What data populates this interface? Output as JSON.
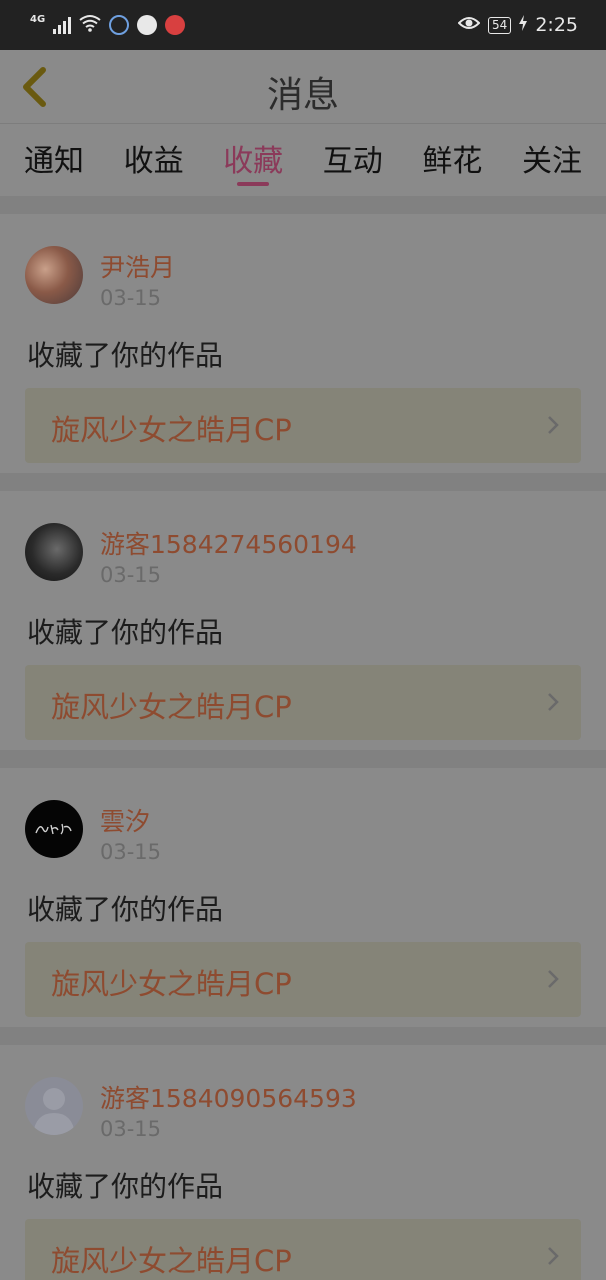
{
  "status_bar": {
    "network": "4G",
    "battery": "54",
    "time": "2:25"
  },
  "header": {
    "title": "消息",
    "back_icon": "chevron-left-icon"
  },
  "tabs": [
    {
      "label": "通知",
      "active": false
    },
    {
      "label": "收益",
      "active": false
    },
    {
      "label": "收藏",
      "active": true
    },
    {
      "label": "互动",
      "active": false
    },
    {
      "label": "鲜花",
      "active": false
    },
    {
      "label": "关注",
      "active": false
    }
  ],
  "feed": [
    {
      "user": "尹浩月",
      "date": "03-15",
      "action": "收藏了你的作品",
      "work": "旋风少女之皓月CP",
      "avatar": "photo"
    },
    {
      "user": "游客1584274560194",
      "date": "03-15",
      "action": "收藏了你的作品",
      "work": "旋风少女之皓月CP",
      "avatar": "dark-photo"
    },
    {
      "user": "雲汐",
      "date": "03-15",
      "action": "收藏了你的作品",
      "work": "旋风少女之皓月CP",
      "avatar": "black-calligraphy"
    },
    {
      "user": "游客1584090564593",
      "date": "03-15",
      "action": "收藏了你的作品",
      "work": "旋风少女之皓月CP",
      "avatar": "default-user"
    }
  ],
  "colors": {
    "accent": "#8b3a5a",
    "name": "#8e4b30",
    "overlay_bg": "#8a8a8a"
  }
}
